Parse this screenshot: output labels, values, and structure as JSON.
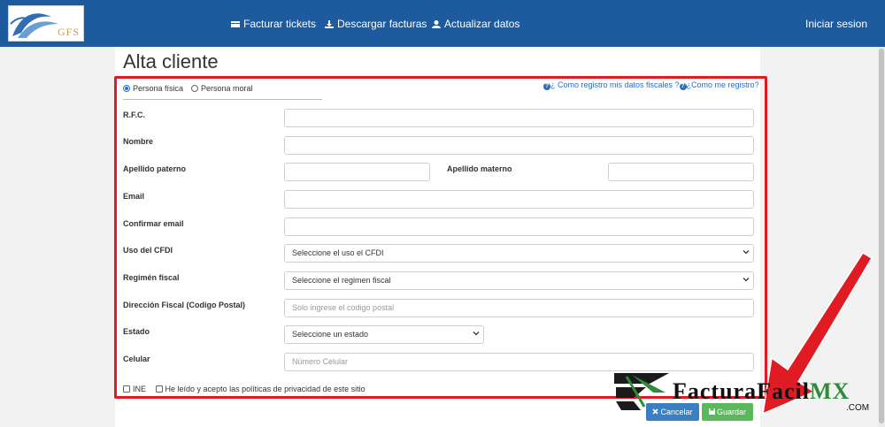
{
  "nav": {
    "facturar_tickets": "Facturar tickets",
    "descargar_facturas": "Descargar facturas",
    "actualizar_datos": "Actualizar datos",
    "iniciar_sesion": "Iniciar sesion",
    "logo_text": "GFS"
  },
  "page": {
    "title": "Alta cliente"
  },
  "form": {
    "person_type": {
      "fisica": "Persona física",
      "moral": "Persona moral",
      "selected": "fisica"
    },
    "help_registro_datos": "¿ Como registro mis datos fiscales ?",
    "help_como_registro": "¿Como me registro?",
    "rfc": {
      "label": "R.F.C.",
      "value": ""
    },
    "nombre": {
      "label": "Nombre",
      "value": ""
    },
    "apellido_paterno": {
      "label": "Apellido paterno",
      "value": ""
    },
    "apellido_materno": {
      "label": "Apellido materno",
      "value": ""
    },
    "email": {
      "label": "Email",
      "value": ""
    },
    "confirmar_email": {
      "label": "Confirmar email",
      "value": ""
    },
    "uso_cfdi": {
      "label": "Uso del CFDI",
      "selected": "Seleccione el uso el CFDI"
    },
    "regimen_fiscal": {
      "label": "Regimén fiscal",
      "selected": "Seleccione el regimen fiscal"
    },
    "direccion_fiscal": {
      "label": "Dirección Fiscal (Codigo Postal)",
      "placeholder": "Solo ingrese el codigo postal"
    },
    "estado": {
      "label": "Estado",
      "selected": "Seleccione un estado"
    },
    "celular": {
      "label": "Celular",
      "placeholder": "Número Celular"
    },
    "ine_label": "INE",
    "privacy_label": "He leído y acepto las políticas de privacidad de este sitio",
    "cancel_label": "Cancelar",
    "save_label": "Guardar"
  },
  "watermark": {
    "brand": "FacturaFacilMX",
    "brand_main": "FacturaFacil",
    "brand_mx": "MX",
    "domain": ".COM"
  },
  "colors": {
    "navbar": "#1d5a9e",
    "highlight": "#e01b24",
    "cancel": "#3a7fc1",
    "save": "#5cb85c",
    "watermark_green": "#2e8b3a"
  }
}
